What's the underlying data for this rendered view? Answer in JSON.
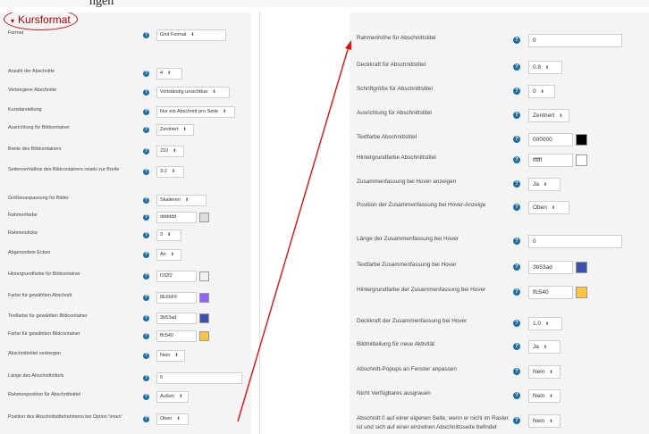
{
  "page": {
    "top_text": "ngen"
  },
  "section": {
    "title": "Kursformat"
  },
  "left_rows": [
    {
      "label": "Format",
      "type": "select",
      "value": "Grid Format",
      "w": 78
    },
    {
      "label": "Anzahl der Abschnitte",
      "type": "select",
      "value": "4",
      "w": 29
    },
    {
      "label": "Verborgene Abschnitte",
      "type": "select",
      "value": "Vollständig unsichtbar",
      "w": 82
    },
    {
      "label": "Kursdarstellung",
      "type": "select",
      "value": "Nur ein Abschnitt pro Seite",
      "w": 88
    },
    {
      "label": "Ausrichtung für Bildcontainer",
      "type": "select",
      "value": "Zentriert",
      "w": 42
    },
    {
      "label": "Breite des Bildcontainers",
      "type": "select",
      "value": "210",
      "w": 31
    },
    {
      "label": "Seitenverhältnis des Bildcontainers relativ zur Breite",
      "type": "select",
      "value": "3-2",
      "w": 31
    },
    {
      "label": "Größenanpassung für Bilder",
      "type": "select",
      "value": "Skalieren",
      "w": 56
    },
    {
      "label": "Rahmenfarbe",
      "type": "color",
      "value": "dddddd",
      "swatch": "#dddddd",
      "w": 45
    },
    {
      "label": "Rahmendicke",
      "type": "select",
      "value": "3",
      "w": 28
    },
    {
      "label": "Abgerundete Ecken",
      "type": "select",
      "value": "An",
      "w": 28
    },
    {
      "label": "Hintergrundfarbe für Bildcontainer",
      "type": "color",
      "value": "f1f2f2",
      "swatch": "#f1f2f2",
      "w": 45
    },
    {
      "label": "Farbe für gewählten Abschnitt",
      "type": "color",
      "value": "8E66FF",
      "swatch": "#8e66ff",
      "w": 45
    },
    {
      "label": "Textfarbe für gewählten Bildcontainer",
      "type": "color",
      "value": "3b53ad",
      "swatch": "#3b53ad",
      "w": 45
    },
    {
      "label": "Farbe für gewählten Bildcontainer",
      "type": "color",
      "value": "ffc540",
      "swatch": "#ffc540",
      "w": 45
    },
    {
      "label": "Abschnittstitel verbergen",
      "type": "select",
      "value": "Nein",
      "w": 32
    },
    {
      "label": "Länge des Abschnittstitels",
      "type": "text",
      "value": "0",
      "w": 96
    },
    {
      "label": "Rahmenposition für Abschnittstitel",
      "type": "select",
      "value": "Außen",
      "w": 36
    },
    {
      "label": "Position des Abschnittstitelrahmens bei Option 'innen'",
      "type": "select",
      "value": "Oben",
      "w": 36
    },
    {
      "label": "Rahmenhöhe für Abschnittstitel",
      "type": "text",
      "value": "0",
      "w": 96
    }
  ],
  "right_rows": [
    {
      "label": "Rahmenhöhe für Abschnittstitel",
      "type": "text",
      "value": "0",
      "w": 105
    },
    {
      "label": "Deckkraft für Abschnittstitel",
      "type": "select",
      "value": "0.8",
      "w": 38
    },
    {
      "label": "Schriftgröße für Abschnittstitel",
      "type": "select",
      "value": "0",
      "w": 30
    },
    {
      "label": "Ausrichtung für Abschnittstitel",
      "type": "select",
      "value": "Zentriert",
      "w": 46
    },
    {
      "label": "Textfarbe Abschnittstitel",
      "type": "color",
      "value": "000000",
      "swatch": "#000000",
      "w": 50
    },
    {
      "label": "Hintergrundfarbe Abschnittstitel",
      "type": "color",
      "value": "ffffff",
      "swatch": "#ffffff",
      "w": 50
    },
    {
      "label": "Zusammenfassung bei Hover anzeigen",
      "type": "select",
      "value": "Ja",
      "w": 36
    },
    {
      "label": "Position der Zusammenfassung bei Hover-Anzeige",
      "type": "select",
      "value": "Oben",
      "w": 46
    },
    {
      "label": "Länge der Zusammenfassung bei Hover",
      "type": "text",
      "value": "0",
      "w": 105
    },
    {
      "label": "Textfarbe Zusammenfassung bei Hover",
      "type": "color",
      "value": "3b53ad",
      "swatch": "#3b53ad",
      "w": 50
    },
    {
      "label": "Hintergrundfarbe der Zusammenfassung bei Hover",
      "type": "color",
      "value": "ffc540",
      "swatch": "#ffc540",
      "w": 50
    },
    {
      "label": "Deckkraft der Zusammenfassung bei Hover",
      "type": "select",
      "value": "1.0",
      "w": 38
    },
    {
      "label": "Bildmitteilung für neue Aktivität",
      "type": "select",
      "value": "Ja",
      "w": 36
    },
    {
      "label": "Abschnitt-Popups an Fenster anpassen",
      "type": "select",
      "value": "Nein",
      "w": 36
    },
    {
      "label": "Nicht Verfügbares ausgrauen",
      "type": "select",
      "value": "Nein",
      "w": 36
    },
    {
      "label": "Abschnitt 0 auf einer eigenen Seite, wenn er nicht im Raster ist und sich auf einer einzelnen Abschnittsseite befindet",
      "type": "select",
      "value": "Nein",
      "w": 36
    }
  ],
  "icons": {
    "help": "question-circle-icon",
    "dropdown": "chevron-up-down-icon"
  },
  "colors": {
    "annotation": "#e01010",
    "help": "#1b6fa8",
    "title": "#b00000"
  }
}
